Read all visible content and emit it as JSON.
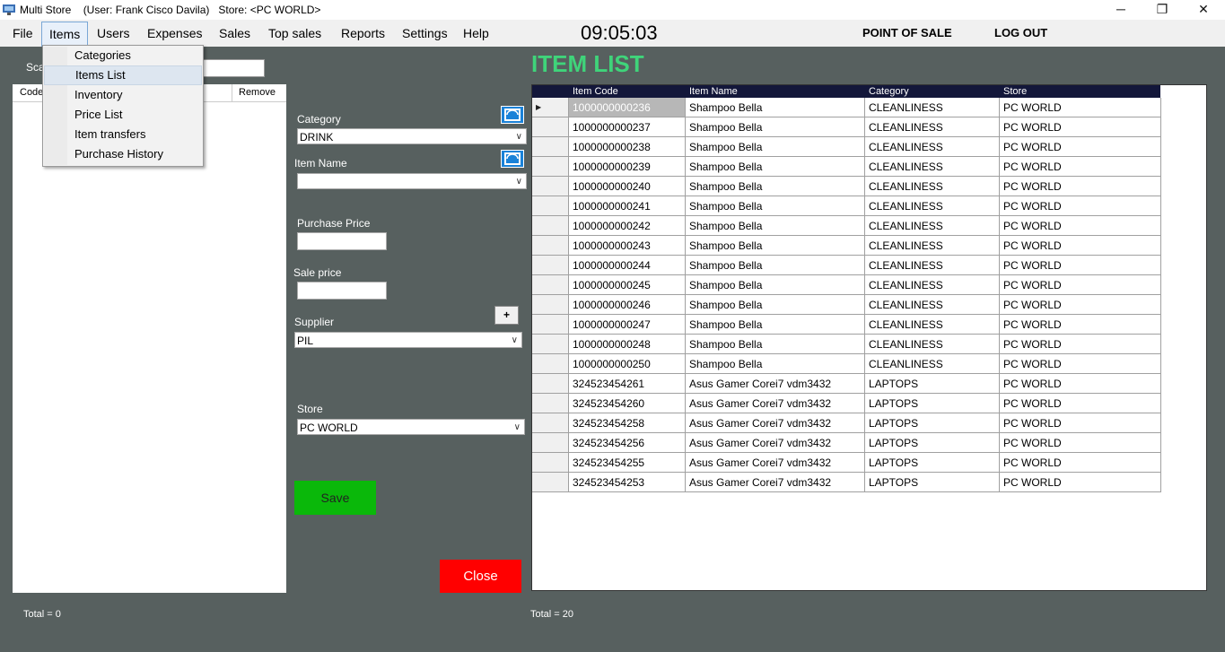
{
  "window": {
    "title": "Multi Store    (User: Frank Cisco Davila)   Store: <PC WORLD>",
    "minimize": "─",
    "maximize": "❐",
    "close": "✕"
  },
  "menu": {
    "items": [
      "File",
      "Items",
      "Users",
      "Expenses",
      "Sales",
      "Top sales",
      "Reports",
      "Settings",
      "Help"
    ],
    "clock": "09:05:03",
    "point_of_sale": "POINT OF SALE",
    "log_out": "LOG OUT"
  },
  "items_dropdown": [
    "Categories",
    "Items List",
    "Inventory",
    "Price List",
    "Item transfers",
    "Purchase History"
  ],
  "left_panel": {
    "scan_label": "Sca",
    "scan_value": "",
    "columns": [
      "Code",
      "Remove"
    ],
    "total": "Total = 0"
  },
  "form": {
    "category_label": "Category",
    "category_value": "DRINK",
    "item_name_label": "Item Name",
    "item_name_value": "",
    "purchase_price_label": "Purchase Price",
    "purchase_price_value": "",
    "sale_price_label": "Sale price",
    "sale_price_value": "",
    "supplier_label": "Supplier",
    "supplier_value": "PIL",
    "add_supplier": "+",
    "store_label": "Store",
    "store_value": "PC WORLD",
    "save": "Save",
    "close": "Close"
  },
  "grid": {
    "title": "ITEM LIST",
    "columns": [
      "Item Code",
      "Item Name",
      "Category",
      "Store"
    ],
    "rows": [
      [
        "1000000000236",
        "Shampoo Bella",
        "CLEANLINESS",
        "PC WORLD"
      ],
      [
        "1000000000237",
        "Shampoo Bella",
        "CLEANLINESS",
        "PC WORLD"
      ],
      [
        "1000000000238",
        "Shampoo Bella",
        "CLEANLINESS",
        "PC WORLD"
      ],
      [
        "1000000000239",
        "Shampoo Bella",
        "CLEANLINESS",
        "PC WORLD"
      ],
      [
        "1000000000240",
        "Shampoo Bella",
        "CLEANLINESS",
        "PC WORLD"
      ],
      [
        "1000000000241",
        "Shampoo Bella",
        "CLEANLINESS",
        "PC WORLD"
      ],
      [
        "1000000000242",
        "Shampoo Bella",
        "CLEANLINESS",
        "PC WORLD"
      ],
      [
        "1000000000243",
        "Shampoo Bella",
        "CLEANLINESS",
        "PC WORLD"
      ],
      [
        "1000000000244",
        "Shampoo Bella",
        "CLEANLINESS",
        "PC WORLD"
      ],
      [
        "1000000000245",
        "Shampoo Bella",
        "CLEANLINESS",
        "PC WORLD"
      ],
      [
        "1000000000246",
        "Shampoo Bella",
        "CLEANLINESS",
        "PC WORLD"
      ],
      [
        "1000000000247",
        "Shampoo Bella",
        "CLEANLINESS",
        "PC WORLD"
      ],
      [
        "1000000000248",
        "Shampoo Bella",
        "CLEANLINESS",
        "PC WORLD"
      ],
      [
        "1000000000250",
        "Shampoo Bella",
        "CLEANLINESS",
        "PC WORLD"
      ],
      [
        "324523454261",
        "Asus Gamer Corei7 vdm3432",
        "LAPTOPS",
        "PC WORLD"
      ],
      [
        "324523454260",
        "Asus Gamer Corei7 vdm3432",
        "LAPTOPS",
        "PC WORLD"
      ],
      [
        "324523454258",
        "Asus Gamer Corei7 vdm3432",
        "LAPTOPS",
        "PC WORLD"
      ],
      [
        "324523454256",
        "Asus Gamer Corei7 vdm3432",
        "LAPTOPS",
        "PC WORLD"
      ],
      [
        "324523454255",
        "Asus Gamer Corei7 vdm3432",
        "LAPTOPS",
        "PC WORLD"
      ],
      [
        "324523454253",
        "Asus Gamer Corei7 vdm3432",
        "LAPTOPS",
        "PC WORLD"
      ]
    ],
    "total": "Total = 20"
  },
  "colors": {
    "background": "#57605f",
    "grid_header": "#13173a",
    "title_green": "#3fd47a",
    "save_green": "#0ab80a",
    "close_red": "#ff0000"
  }
}
